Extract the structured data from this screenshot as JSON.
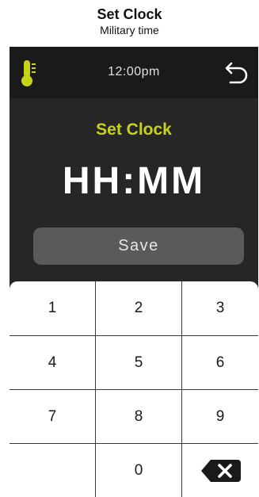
{
  "caption": {
    "title": "Set Clock",
    "subtitle": "Military time"
  },
  "status_bar": {
    "time": "12:00pm",
    "left_icon": "thermometer-icon",
    "right_icon": "back-arrow-icon"
  },
  "screen": {
    "title": "Set Clock",
    "time_display": "HH:MM",
    "save_label": "Save"
  },
  "keypad": {
    "keys": [
      "1",
      "2",
      "3",
      "4",
      "5",
      "6",
      "7",
      "8",
      "9",
      "",
      "0",
      "backspace"
    ],
    "backspace_icon": "backspace-icon"
  },
  "colors": {
    "accent": "#c7d317",
    "screen_background": "#262626",
    "status_bar_background": "#1a1a1a",
    "button_background": "#5a5a5a",
    "keypad_background": "#ffffff"
  }
}
